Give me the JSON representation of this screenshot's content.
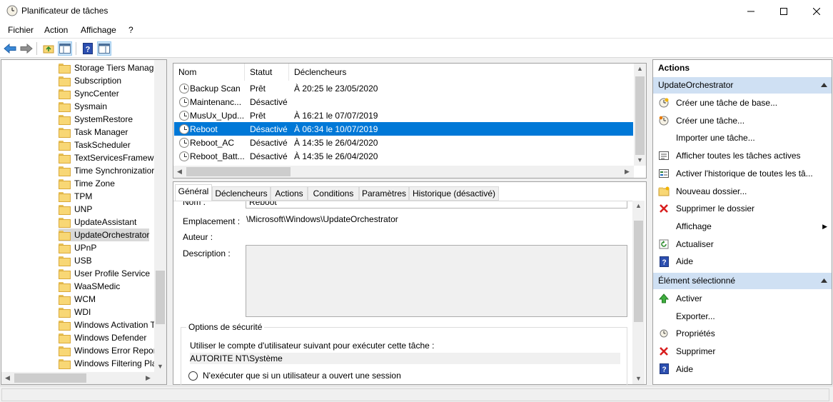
{
  "window": {
    "title": "Planificateur de tâches"
  },
  "menu": [
    "Fichier",
    "Action",
    "Affichage",
    "?"
  ],
  "tree": {
    "items": [
      "Storage Tiers Manage",
      "Subscription",
      "SyncCenter",
      "Sysmain",
      "SystemRestore",
      "Task Manager",
      "TaskScheduler",
      "TextServicesFramewo",
      "Time Synchronizatior",
      "Time Zone",
      "TPM",
      "UNP",
      "UpdateAssistant",
      "UpdateOrchestrator",
      "UPnP",
      "USB",
      "User Profile Service",
      "WaaSMedic",
      "WCM",
      "WDI",
      "Windows Activation T",
      "Windows Defender",
      "Windows Error Repor",
      "Windows Filtering Pla"
    ],
    "selected": "UpdateOrchestrator"
  },
  "tasklist": {
    "columns": [
      "Nom",
      "Statut",
      "Déclencheurs"
    ],
    "rows": [
      {
        "name": "Backup Scan",
        "status": "Prêt",
        "trigger": "À 20:25 le 23/05/2020"
      },
      {
        "name": "Maintenanc...",
        "status": "Désactivé",
        "trigger": ""
      },
      {
        "name": "MusUx_Upd...",
        "status": "Prêt",
        "trigger": "À 16:21 le 07/07/2019"
      },
      {
        "name": "Reboot",
        "status": "Désactivé",
        "trigger": "À 06:34 le 10/07/2019"
      },
      {
        "name": "Reboot_AC",
        "status": "Désactivé",
        "trigger": "À 14:35 le 26/04/2020"
      },
      {
        "name": "Reboot_Batt...",
        "status": "Désactivé",
        "trigger": "À 14:35 le 26/04/2020"
      }
    ],
    "selected": "Reboot"
  },
  "details": {
    "tabs": [
      "Général",
      "Déclencheurs",
      "Actions",
      "Conditions",
      "Paramètres",
      "Historique (désactivé)"
    ],
    "active_tab": "Général",
    "name_label": "Nom :",
    "name_value": "Reboot",
    "location_label": "Emplacement :",
    "location_value": "\\Microsoft\\Windows\\UpdateOrchestrator",
    "author_label": "Auteur :",
    "description_label": "Description :",
    "security_group": "Options de sécurité",
    "run_as_label": "Utiliser le compte d'utilisateur suivant pour exécuter cette tâche :",
    "run_as_value": "AUTORITE NT\\Système",
    "radio_logged_on": "N'exécuter que si un utilisateur a ouvert une session"
  },
  "actions": {
    "header": "Actions",
    "section1": {
      "title": "UpdateOrchestrator",
      "items": [
        {
          "label": "Créer une tâche de base...",
          "icon": "create-basic-task-icon"
        },
        {
          "label": "Créer une tâche...",
          "icon": "create-task-icon"
        },
        {
          "label": "Importer une tâche...",
          "icon": ""
        },
        {
          "label": "Afficher toutes les tâches actives",
          "icon": "active-tasks-icon"
        },
        {
          "label": "Activer l'historique de toutes les tâ...",
          "icon": "history-icon"
        },
        {
          "label": "Nouveau dossier...",
          "icon": "new-folder-icon"
        },
        {
          "label": "Supprimer le dossier",
          "icon": "delete-icon"
        },
        {
          "label": "Affichage",
          "icon": ""
        },
        {
          "label": "Actualiser",
          "icon": "refresh-icon"
        },
        {
          "label": "Aide",
          "icon": "help-icon"
        }
      ]
    },
    "section2": {
      "title": "Élément sélectionné",
      "items": [
        {
          "label": "Activer",
          "icon": "enable-arrow-icon"
        },
        {
          "label": "Exporter...",
          "icon": ""
        },
        {
          "label": "Propriétés",
          "icon": "properties-icon"
        },
        {
          "label": "Supprimer",
          "icon": "delete-icon"
        },
        {
          "label": "Aide",
          "icon": "help-icon"
        }
      ]
    }
  },
  "colors": {
    "selection": "#0078d7",
    "section_header": "#cfe0f3",
    "folder": "#f8d775"
  }
}
